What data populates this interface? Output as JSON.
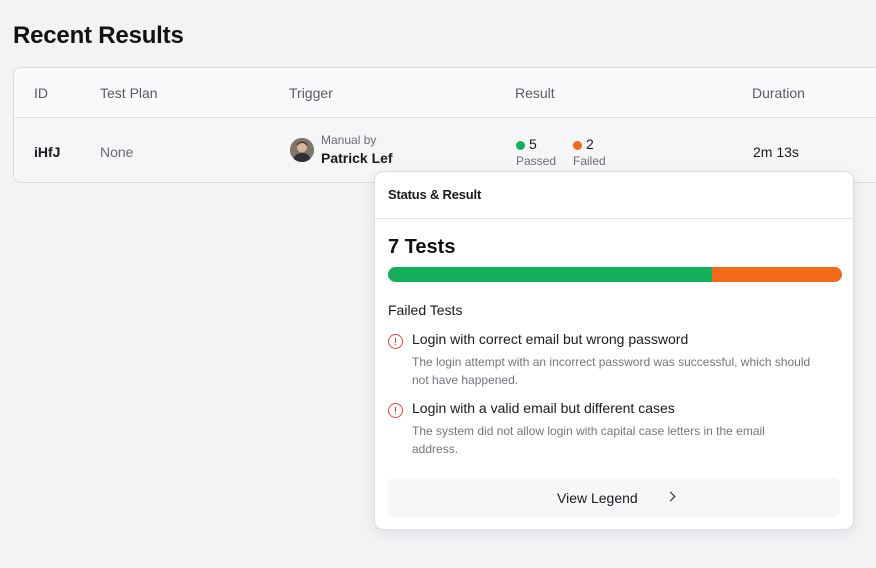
{
  "page": {
    "title": "Recent Results"
  },
  "table": {
    "columns": [
      "ID",
      "Test Plan",
      "Trigger",
      "Result",
      "Duration"
    ],
    "rows": [
      {
        "id": "iHfJ",
        "test_plan": "None",
        "trigger_type": "Manual by",
        "trigger_user": "Patrick Lef",
        "passed_count": "5",
        "passed_label": "Passed",
        "failed_count": "2",
        "failed_label": "Failed",
        "duration": "2m 13s"
      }
    ]
  },
  "popover": {
    "title": "Status & Result",
    "tests_summary": "7 Tests",
    "progress": {
      "passed": 5,
      "failed": 2,
      "total": 7
    },
    "failed_heading": "Failed Tests",
    "failed_tests": [
      {
        "title": "Login with correct email but wrong password",
        "description": "The login attempt with an incorrect password was successful, which should not have happened."
      },
      {
        "title": "Login with a valid email but different cases",
        "description": "The system did not allow login with capital case letters in the email address."
      }
    ],
    "legend_button": "View Legend"
  },
  "colors": {
    "passed": "#13b05a",
    "failed": "#f26a18",
    "error_icon": "#e0483b"
  },
  "icons": [
    "user-avatar",
    "alert-circle-icon",
    "chevron-right-icon"
  ]
}
